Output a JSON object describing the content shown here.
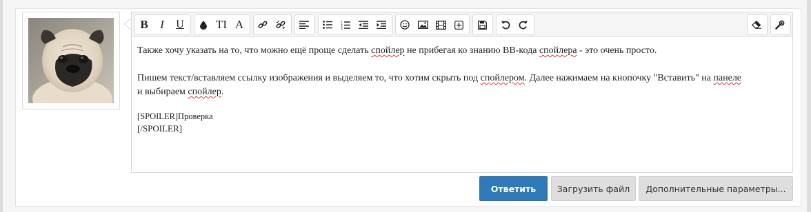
{
  "toolbar": {
    "groups": [
      [
        "bold-icon",
        "italic-icon",
        "underline-icon"
      ],
      [
        "color-drop-icon",
        "text-size-icon",
        "font-icon"
      ],
      [
        "link-icon",
        "unlink-icon"
      ],
      [
        "align-left-icon"
      ],
      [
        "bullet-list-icon",
        "numbered-list-icon",
        "outdent-icon",
        "indent-icon"
      ],
      [
        "smiley-icon",
        "image-icon",
        "media-icon",
        "insert-plus-icon"
      ],
      [
        "save-draft-icon"
      ],
      [
        "undo-icon",
        "redo-icon"
      ],
      [
        "eraser-icon"
      ],
      [
        "wrench-icon"
      ]
    ],
    "bold_label": "B",
    "italic_label": "I",
    "underline_label": "U",
    "textsize_label": "TI",
    "font_label": "A"
  },
  "editor": {
    "p1_a": "Также хочу указать на то, что можно ещё проще сделать ",
    "p1_b": "спойлер",
    "p1_c": " не прибегая ко знанию BB-кода ",
    "p1_d": "спойлера",
    "p1_e": " - это очень просто.",
    "p2_a": "Пишем текст/вставляем ссылку изображения и выделяем то, что хотим скрыть под ",
    "p2_b": "спойлером",
    "p2_c": ". Далее нажимаем на кнопочку \"Вставить\" на ",
    "p2_d": "панеле",
    "p3_a": "и выбираем ",
    "p3_b": "спойлер",
    "p3_c": ".",
    "code1": "[SPOILER]Проверка",
    "code2": "[/SPOILER]"
  },
  "buttons": {
    "reply": "Ответить",
    "upload": "Загрузить файл",
    "more": "Дополнительные параметры..."
  },
  "colors": {
    "primary": "#2f7ab9",
    "secondary": "#dedede",
    "spell_underline": "#dd3333"
  }
}
